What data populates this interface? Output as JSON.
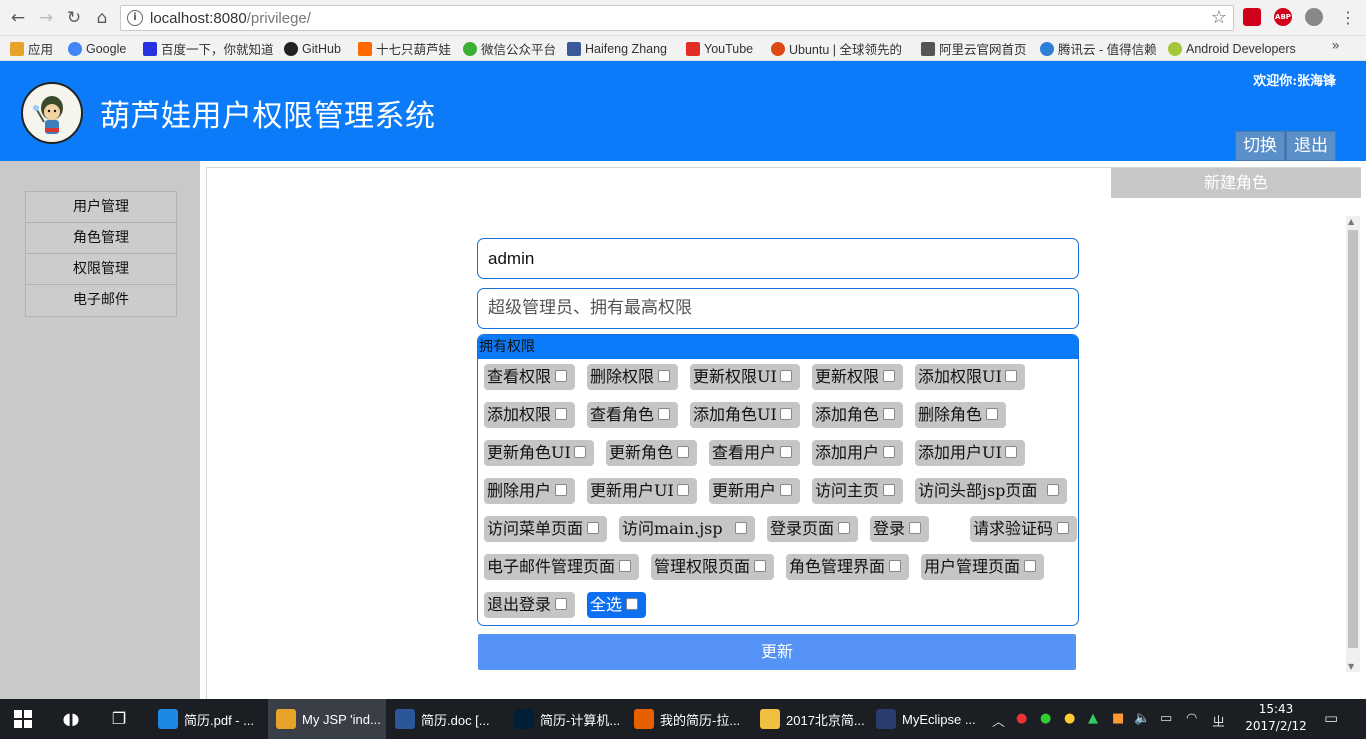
{
  "browser": {
    "url_host": "localhost:8080",
    "url_path": "/privilege/",
    "bookmarks": [
      {
        "label": "应用",
        "color": "#e8a32a"
      },
      {
        "label": "Google",
        "color": "#4285f4"
      },
      {
        "label": "百度一下，你就知道",
        "color": "#2932e1"
      },
      {
        "label": "GitHub",
        "color": "#222222"
      },
      {
        "label": "十七只葫芦娃",
        "color": "#ff6a00"
      },
      {
        "label": "微信公众平台",
        "color": "#3cb034"
      },
      {
        "label": "Haifeng Zhang",
        "color": "#3b5998"
      },
      {
        "label": "YouTube",
        "color": "#e52d27"
      },
      {
        "label": "Ubuntu | 全球领先的",
        "color": "#dd4814"
      },
      {
        "label": "阿里云官网首页",
        "color": "#555555"
      },
      {
        "label": "腾讯云 - 值得信赖",
        "color": "#2f7ed8"
      },
      {
        "label": "Android Developers",
        "color": "#a4c639"
      }
    ],
    "more": "»"
  },
  "header": {
    "title": "葫芦娃用户权限管理系统",
    "welcome": "欢迎你:张海锋",
    "switch_label": "切换",
    "logout_label": "退出",
    "accent": "#0b7bfa"
  },
  "sidebar": {
    "items": [
      {
        "label": "用户管理"
      },
      {
        "label": "角色管理"
      },
      {
        "label": "权限管理"
      },
      {
        "label": "电子邮件"
      }
    ]
  },
  "main": {
    "new_role_label": "新建角色",
    "role_name_value": "admin",
    "role_desc_value": "超级管理员、拥有最高权限",
    "perm_header": "拥有权限",
    "perm_rows": [
      [
        "查看权限",
        "删除权限",
        "更新权限UI",
        "更新权限",
        "添加权限UI"
      ],
      [
        "添加权限",
        "查看角色",
        "添加角色UI",
        "添加角色",
        "删除角色"
      ],
      [
        "更新角色UI",
        "更新角色",
        "查看用户",
        "添加用户",
        "添加用户UI"
      ],
      [
        "删除用户",
        "更新用户UI",
        "更新用户",
        "访问主页",
        "访问头部jsp页面"
      ],
      [
        "访问菜单页面",
        "访问main.jsp",
        "登录页面",
        "登录",
        "请求验证码"
      ],
      [
        "电子邮件管理页面",
        "管理权限页面",
        "角色管理界面",
        "用户管理页面"
      ],
      [
        "退出登录"
      ]
    ],
    "select_all_label": "全选",
    "update_label": "更新"
  },
  "taskbar": {
    "tasks": [
      {
        "label": "简历.pdf - ...",
        "icon": "e",
        "color": "#1e88e5"
      },
      {
        "label": "My JSP 'ind...",
        "icon": "chrome",
        "color": "#e8a32a"
      },
      {
        "label": "简历.doc [...",
        "icon": "W",
        "color": "#2b579a"
      },
      {
        "label": "简历-计算机...",
        "icon": "Ps",
        "color": "#001e36"
      },
      {
        "label": "我的简历-拉...",
        "icon": "firefox",
        "color": "#e66000"
      },
      {
        "label": "2017北京简...",
        "icon": "folder",
        "color": "#f0c040"
      },
      {
        "label": "MyEclipse ...",
        "icon": "ME",
        "color": "#2a3b6e"
      }
    ],
    "time": "15:43",
    "date": "2017/2/12"
  }
}
